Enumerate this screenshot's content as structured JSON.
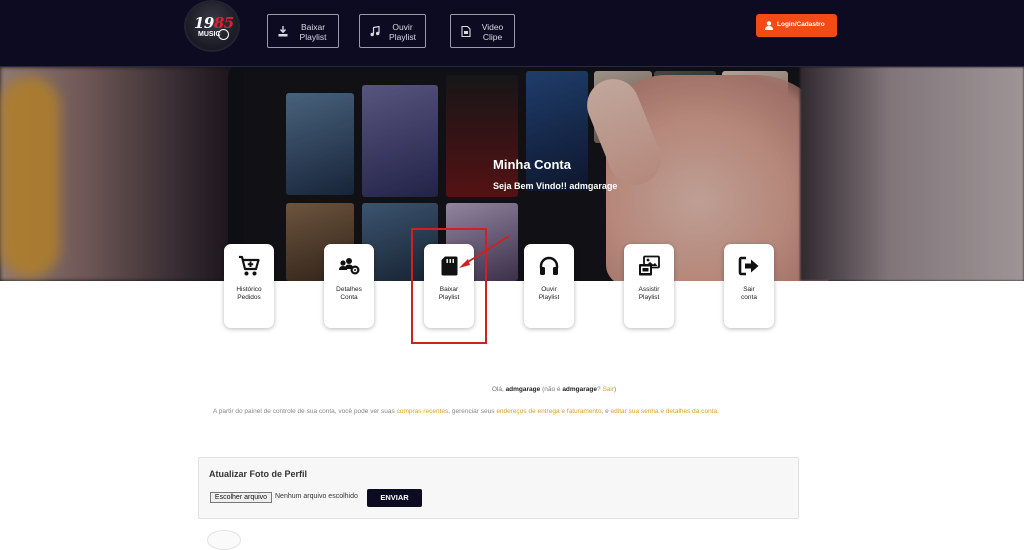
{
  "header": {
    "logo": {
      "top_text": "19",
      "top_text_red": "85",
      "sub_text": "MUSIC"
    },
    "nav": [
      {
        "label_line1": "Baixar",
        "label_line2": "Playlist",
        "icon": "download-icon"
      },
      {
        "label_line1": "Ouvir",
        "label_line2": "Playlist",
        "icon": "music-note-icon"
      },
      {
        "label_line1": "Video",
        "label_line2": "Clipe",
        "icon": "file-icon"
      }
    ],
    "login_label": "Login/Cadastro"
  },
  "hero": {
    "title": "Minha Conta",
    "subtitle": "Seja Bem Vindo!! admgarage"
  },
  "cards": [
    {
      "line1": "Histórico",
      "line2": "Pedidos",
      "icon": "cart-plus-icon"
    },
    {
      "line1": "Detalhes",
      "line2": "Conta",
      "icon": "users-gear-icon"
    },
    {
      "line1": "Baixar",
      "line2": "Playlist",
      "icon": "sd-card-icon"
    },
    {
      "line1": "Ouvir",
      "line2": "Playlist",
      "icon": "headphones-icon"
    },
    {
      "line1": "Assistir",
      "line2": "Playlist",
      "icon": "photo-video-icon"
    },
    {
      "line1": "Sair",
      "line2": "conta",
      "icon": "sign-out-icon"
    }
  ],
  "account": {
    "hello_prefix": "Olá,",
    "username": "admgarage",
    "not_prefix": "(não é",
    "not_username": "admgarage",
    "question": "?",
    "logout_link": "Sair",
    "close_paren": ")",
    "desc_part1": "A partir do painel de controle de sua conta, você pode ver suas",
    "desc_link1": "compras recentes",
    "desc_part2": ", gerenciar seus",
    "desc_link2": "endereços de entrega e faturamento",
    "desc_part3": ", e",
    "desc_link3": "editar sua senha e detalhes da conta",
    "desc_part4": "."
  },
  "profile": {
    "title": "Atualizar Foto de Perfil",
    "choose_file_label": "Escolher arquivo",
    "no_file_label": "Nenhum arquivo escolhido",
    "submit_label": "ENVIAR"
  },
  "colors": {
    "header_bg": "#0d0b22",
    "login_bg": "#f24b16",
    "link": "#e0a020",
    "highlight": "#d02020"
  }
}
